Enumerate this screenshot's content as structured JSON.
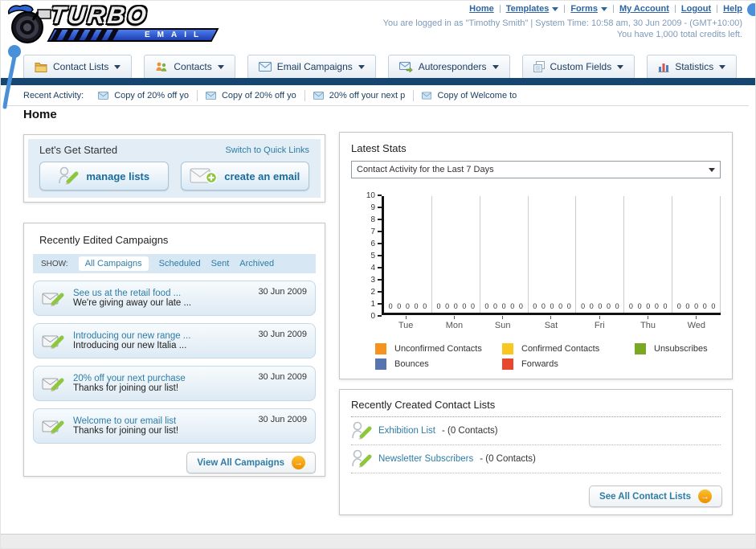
{
  "header": {
    "logo": {
      "line1": "TURBO",
      "line2": "EMAIL"
    },
    "nav_links": [
      "Home",
      "Templates",
      "Forms",
      "My Account",
      "Logout",
      "Help"
    ],
    "login_info": "You are logged in as \"Timothy Smith\" | System Time: 10:58 am, 30 Jun 2009 - (GMT+10:00)",
    "credits": "You have 1,000 total credits left."
  },
  "tabs": [
    {
      "label": "Contact Lists"
    },
    {
      "label": "Contacts"
    },
    {
      "label": "Email Campaigns"
    },
    {
      "label": "Autoresponders"
    },
    {
      "label": "Custom Fields"
    },
    {
      "label": "Statistics"
    }
  ],
  "recent_activity": {
    "label": "Recent Activity:",
    "items": [
      "Copy of 20% off yo",
      "Copy of 20% off yo",
      "20% off your next p",
      "Copy of Welcome to"
    ]
  },
  "page_title": "Home",
  "get_started": {
    "title": "Let's Get Started",
    "switch_link": "Switch to Quick Links",
    "manage_lists_label": "manage lists",
    "create_email_label": "create an email"
  },
  "campaigns": {
    "title": "Recently Edited Campaigns",
    "show_label": "SHOW:",
    "filters": [
      "All Campaigns",
      "Scheduled",
      "Sent",
      "Archived"
    ],
    "items": [
      {
        "title": "See us at the retail food ...",
        "subtitle": "We're giving away our late ...",
        "date": "30 Jun 2009"
      },
      {
        "title": "Introducing our new range ...",
        "subtitle": "Introducing our new Italia ...",
        "date": "30 Jun 2009"
      },
      {
        "title": "20% off your next purchase",
        "subtitle": "Thanks for joining our list!",
        "date": "30 Jun 2009"
      },
      {
        "title": "Welcome to our email list",
        "subtitle": "Thanks for joining our list!",
        "date": "30 Jun 2009"
      }
    ],
    "view_all": "View All Campaigns",
    "arrow_glyph": "→"
  },
  "stats": {
    "title": "Latest Stats",
    "dropdown_value": "Contact Activity for the Last 7 Days"
  },
  "chart_data": {
    "type": "bar",
    "title": "Contact Activity for the Last 7 Days",
    "categories": [
      "Tue",
      "Mon",
      "Sun",
      "Sat",
      "Fri",
      "Thu",
      "Wed"
    ],
    "series": [
      {
        "name": "Unconfirmed Contacts",
        "color": "#F6921E",
        "values": [
          0,
          0,
          0,
          0,
          0,
          0,
          0
        ]
      },
      {
        "name": "Confirmed Contacts",
        "color": "#F9C71F",
        "values": [
          0,
          0,
          0,
          0,
          0,
          0,
          0
        ]
      },
      {
        "name": "Unsubscribes",
        "color": "#7AA823",
        "values": [
          0,
          0,
          0,
          0,
          0,
          0,
          0
        ]
      },
      {
        "name": "Bounces",
        "color": "#5674B0",
        "values": [
          0,
          0,
          0,
          0,
          0,
          0,
          0
        ]
      },
      {
        "name": "Forwards",
        "color": "#E7472C",
        "values": [
          0,
          0,
          0,
          0,
          0,
          0,
          0
        ]
      }
    ],
    "ylim": [
      0,
      10
    ],
    "yticks": [
      0,
      1,
      2,
      3,
      4,
      5,
      6,
      7,
      8,
      9,
      10
    ],
    "grid": "vertical",
    "legend_position": "bottom"
  },
  "contact_lists": {
    "title": "Recently Created Contact Lists",
    "items": [
      {
        "name": "Exhibition List",
        "info": "- (0 Contacts)"
      },
      {
        "name": "Newsletter Subscribers",
        "info": "- (0 Contacts)"
      }
    ],
    "see_all": "See All Contact Lists",
    "arrow_glyph": "→"
  }
}
